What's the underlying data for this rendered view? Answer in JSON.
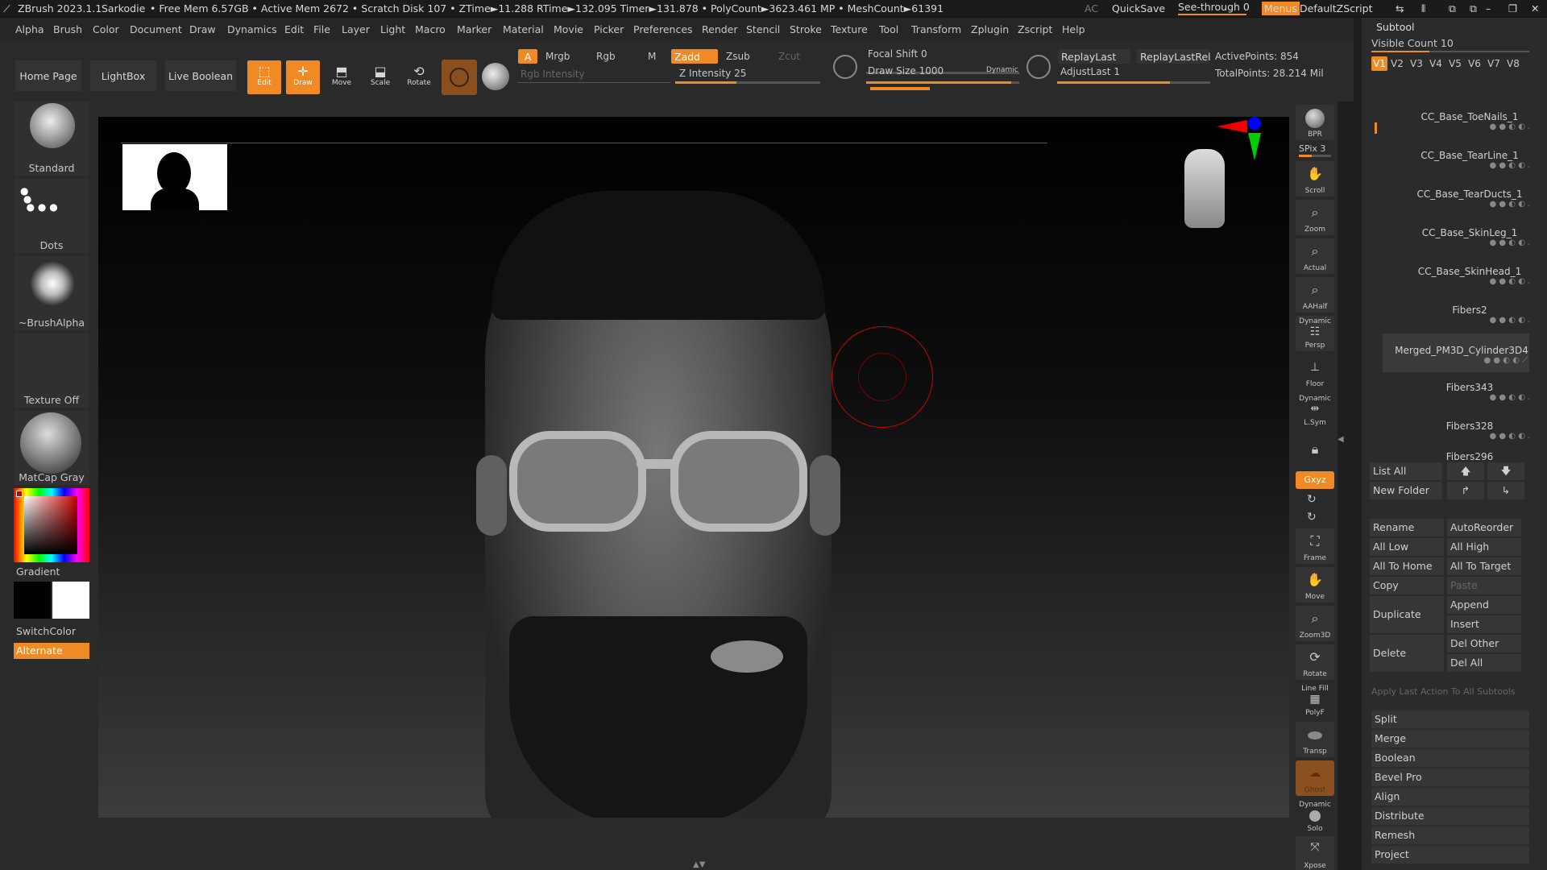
{
  "titlebar": {
    "app": "ZBrush 2023.1.1",
    "project": "Sarkodie",
    "stats": "• Free Mem 6.57GB • Active Mem 2672 • Scratch Disk 107 • ZTime►11.288 RTime►132.095 Timer►131.878 • PolyCount►3623.461 MP • MeshCount►61391",
    "ac": "AC",
    "quicksave": "QuickSave",
    "see_through": "See-through  0",
    "menus": "Menus",
    "default_zscript": "DefaultZScript"
  },
  "menubar": [
    "Alpha",
    "Brush",
    "Color",
    "Document",
    "Draw",
    "Dynamics",
    "Edit",
    "File",
    "Layer",
    "Light",
    "Macro",
    "Marker",
    "Material",
    "Movie",
    "Picker",
    "Preferences",
    "Render",
    "Stencil",
    "Stroke",
    "Texture",
    "Tool",
    "Transform",
    "Zplugin",
    "Zscript",
    "Help"
  ],
  "toolbar": {
    "home_page": "Home Page",
    "lightbox": "LightBox",
    "live_boolean": "Live Boolean",
    "edit": "Edit",
    "draw": "Draw",
    "move": "Move",
    "scale": "Scale",
    "rotate": "Rotate",
    "a": "A",
    "mrgb": "Mrgb",
    "rgb": "Rgb",
    "m": "M",
    "zadd": "Zadd",
    "zsub": "Zsub",
    "zcut": "Zcut",
    "rgb_intensity": "Rgb Intensity",
    "z_intensity": "Z Intensity 25",
    "focal_shift": "Focal Shift 0",
    "draw_size": "Draw Size 1000",
    "dynamic": "Dynamic",
    "replay_last": "ReplayLast",
    "replay_last_rel": "ReplayLastRel",
    "adjust_last": "AdjustLast 1",
    "active_points": "ActivePoints: 854",
    "total_points": "TotalPoints: 28.214 Mil"
  },
  "leftshelf": {
    "brush": "Standard",
    "stroke": "Dots",
    "alpha": "~BrushAlpha",
    "texture": "Texture Off",
    "material": "MatCap Gray",
    "gradient": "Gradient",
    "switch_color": "SwitchColor",
    "alternate": "Alternate"
  },
  "rightstrip": {
    "bpr": "BPR",
    "spix": "SPix 3",
    "scroll": "Scroll",
    "zoom": "Zoom",
    "actual": "Actual",
    "aahalf": "AAHalf",
    "persp_top": "Dynamic",
    "persp": "Persp",
    "floor": "Floor",
    "lsym_top": "Dynamic",
    "lsym": "L.Sym",
    "xyz": "Gxyz",
    "frame": "Frame",
    "move": "Move",
    "zoom3d": "Zoom3D",
    "rotate": "Rotate",
    "polyf_top": "Line Fill",
    "polyf": "PolyF",
    "transp": "Transp",
    "ghost": "Ghost",
    "solo_top": "Dynamic",
    "solo": "Solo",
    "xpose": "Xpose"
  },
  "subtool": {
    "header": "Subtool",
    "visible_count": "Visible Count 10",
    "versions": [
      "V1",
      "V2",
      "V3",
      "V4",
      "V5",
      "V6",
      "V7",
      "V8"
    ],
    "items": [
      "CC_Base_ToeNails_1",
      "CC_Base_TearLine_1",
      "CC_Base_TearDucts_1",
      "CC_Base_SkinLeg_1",
      "CC_Base_SkinHead_1",
      "Fibers2",
      "Merged_PM3D_Cylinder3D4",
      "Fibers343",
      "Fibers328",
      "Fibers296"
    ],
    "list_all": "List All",
    "new_folder": "New Folder",
    "buttons_left": [
      "Rename",
      "All Low",
      "All To Home",
      "Copy"
    ],
    "buttons_right": [
      "AutoReorder",
      "All High",
      "All To Target",
      "Paste"
    ],
    "duplicate": "Duplicate",
    "append": "Append",
    "insert": "Insert",
    "delete": "Delete",
    "del_other": "Del Other",
    "del_all": "Del All",
    "apply_last": "Apply Last Action To All Subtools",
    "sections": [
      "Split",
      "Merge",
      "Boolean",
      "Bevel Pro",
      "Align",
      "Distribute",
      "Remesh",
      "Project"
    ]
  }
}
